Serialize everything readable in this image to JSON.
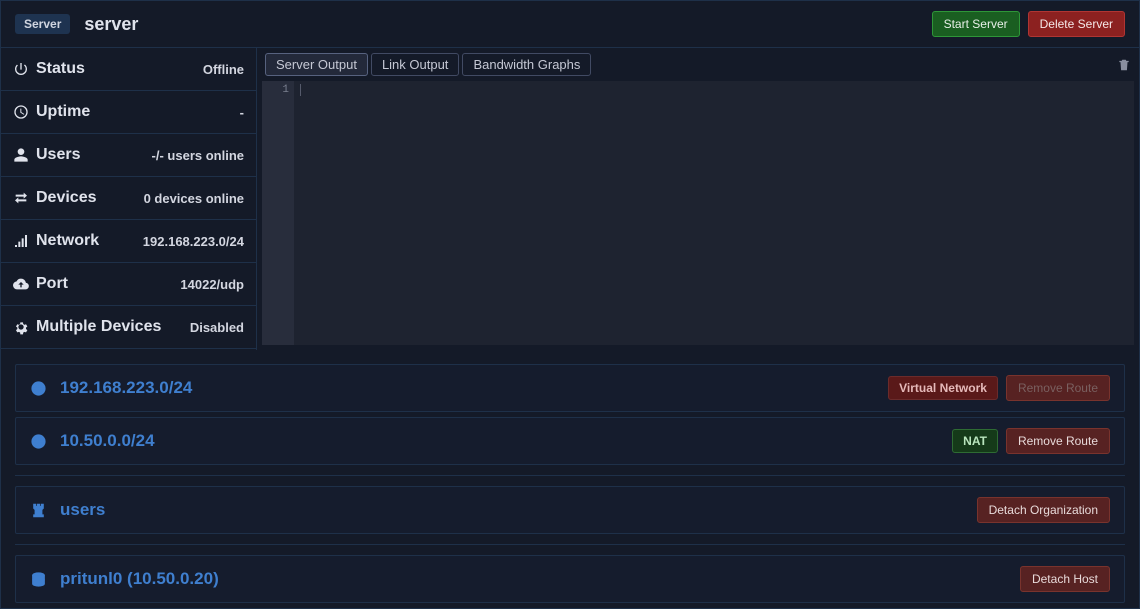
{
  "header": {
    "badge": "Server",
    "title": "server",
    "start_label": "Start Server",
    "delete_label": "Delete Server"
  },
  "sidebar": {
    "status_label": "Status",
    "status_value": "Offline",
    "uptime_label": "Uptime",
    "uptime_value": "-",
    "users_label": "Users",
    "users_value": "-/- users online",
    "devices_label": "Devices",
    "devices_value": "0 devices online",
    "network_label": "Network",
    "network_value": "192.168.223.0/24",
    "port_label": "Port",
    "port_value": "14022/udp",
    "multidev_label": "Multiple Devices",
    "multidev_value": "Disabled"
  },
  "tabs": {
    "server_output": "Server Output",
    "link_output": "Link Output",
    "bandwidth": "Bandwidth Graphs"
  },
  "editor": {
    "line_num": "1"
  },
  "routes": [
    {
      "addr": "192.168.223.0/24",
      "badge": "Virtual Network",
      "badge_type": "vn",
      "remove_disabled": true
    },
    {
      "addr": "10.50.0.0/24",
      "badge": "NAT",
      "badge_type": "nat",
      "remove_disabled": false
    }
  ],
  "route_remove_label": "Remove Route",
  "org": {
    "name": "users",
    "detach_label": "Detach Organization"
  },
  "host": {
    "name": "pritunl0 (10.50.0.20)",
    "detach_label": "Detach Host"
  }
}
